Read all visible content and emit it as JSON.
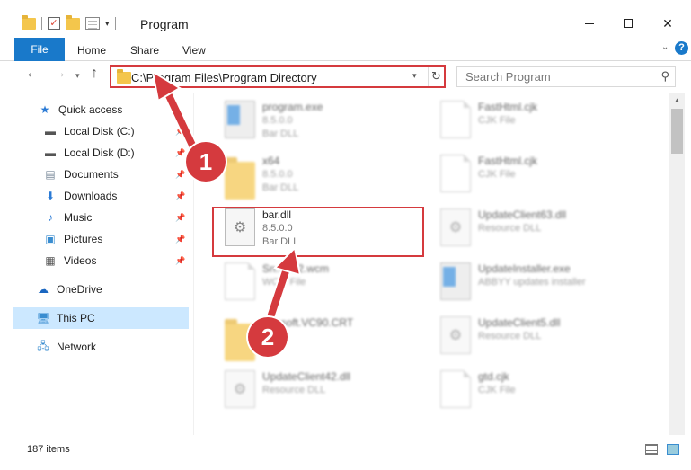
{
  "window": {
    "title": "Program",
    "minimize": "—",
    "maximize": "☐",
    "close": "✕"
  },
  "ribbon": {
    "tabs": [
      "File",
      "Home",
      "Share",
      "View"
    ]
  },
  "address": {
    "path": "C:\\Program Files\\Program Directory",
    "search_placeholder": "Search Program"
  },
  "nav": {
    "quick_access": "Quick access",
    "items": [
      "Local Disk (C:)",
      "Local Disk (D:)",
      "Documents",
      "Downloads",
      "Music",
      "Pictures",
      "Videos"
    ],
    "onedrive": "OneDrive",
    "this_pc": "This PC",
    "network": "Network"
  },
  "files": {
    "left": [
      {
        "name": "program.exe",
        "l2": "8.5.0.0",
        "l3": "Bar DLL"
      },
      {
        "name": "x64",
        "l2": "8.5.0.0",
        "l3": "Bar DLL"
      },
      {
        "name": "bar.dll",
        "l2": "8.5.0.0",
        "l3": "Bar DLL"
      },
      {
        "name": "Sn...P12.wcm",
        "l2": "WC... File",
        "l3": ""
      },
      {
        "name": "...rosoft.VC90.CRT",
        "l2": "",
        "l3": ""
      },
      {
        "name": "UpdateClient42.dll",
        "l2": "Resource DLL",
        "l3": ""
      }
    ],
    "right": [
      {
        "name": "FastHtml.cjk",
        "l2": "CJK File",
        "l3": ""
      },
      {
        "name": "FastHtml.cjk",
        "l2": "CJK File",
        "l3": ""
      },
      {
        "name": "UpdateClient63.dll",
        "l2": "Resource DLL",
        "l3": ""
      },
      {
        "name": "UpdateInstaller.exe",
        "l2": "ABBYY updates installer",
        "l3": ""
      },
      {
        "name": "UpdateClient5.dll",
        "l2": "Resource DLL",
        "l3": ""
      },
      {
        "name": "gtd.cjk",
        "l2": "CJK File",
        "l3": ""
      }
    ]
  },
  "status": {
    "items": "187 items"
  },
  "annotations": {
    "step1": "1",
    "step2": "2",
    "color": "#d53a3e"
  }
}
